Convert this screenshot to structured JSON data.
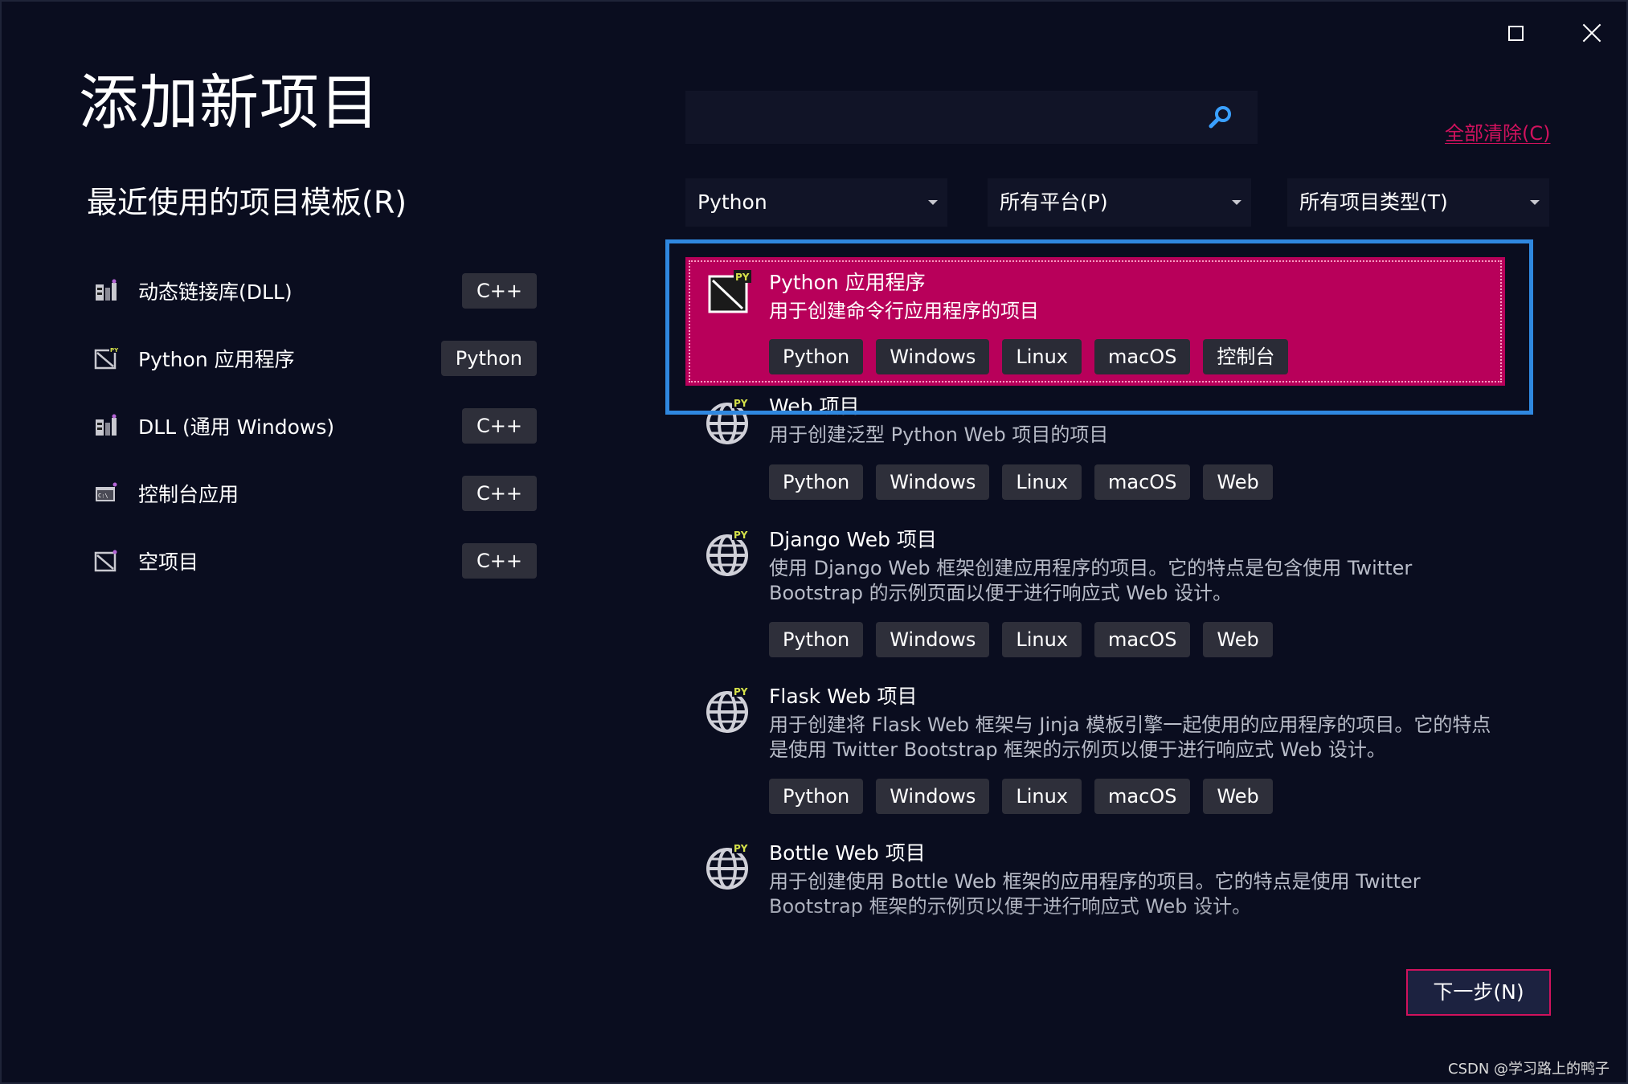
{
  "page_title": "添加新项目",
  "recent": {
    "title": "最近使用的项目模板(R)",
    "items": [
      {
        "label": "动态链接库(DLL)",
        "tag": "C++",
        "icon": "dll-icon"
      },
      {
        "label": "Python 应用程序",
        "tag": "Python",
        "icon": "python-app-icon"
      },
      {
        "label": "DLL (通用 Windows)",
        "tag": "C++",
        "icon": "dll-icon"
      },
      {
        "label": "控制台应用",
        "tag": "C++",
        "icon": "console-icon"
      },
      {
        "label": "空项目",
        "tag": "C++",
        "icon": "empty-project-icon"
      }
    ]
  },
  "search": {
    "value": "",
    "placeholder": ""
  },
  "clear_all_label": "全部清除(C)",
  "filters": {
    "language": "Python",
    "platform": "所有平台(P)",
    "project_type": "所有项目类型(T)"
  },
  "results": [
    {
      "title": "Python 应用程序",
      "desc": "用于创建命令行应用程序的项目",
      "tags": [
        "Python",
        "Windows",
        "Linux",
        "macOS",
        "控制台"
      ],
      "selected": true
    },
    {
      "title": "Web 项目",
      "desc": "用于创建泛型 Python Web 项目的项目",
      "tags": [
        "Python",
        "Windows",
        "Linux",
        "macOS",
        "Web"
      ]
    },
    {
      "title": "Django Web 项目",
      "desc": "使用 Django Web 框架创建应用程序的项目。它的特点是包含使用 Twitter Bootstrap 的示例页面以便于进行响应式 Web 设计。",
      "tags": [
        "Python",
        "Windows",
        "Linux",
        "macOS",
        "Web"
      ]
    },
    {
      "title": "Flask Web 项目",
      "desc": "用于创建将 Flask Web 框架与 Jinja 模板引擎一起使用的应用程序的项目。它的特点是使用 Twitter Bootstrap 框架的示例页以便于进行响应式 Web 设计。",
      "tags": [
        "Python",
        "Windows",
        "Linux",
        "macOS",
        "Web"
      ]
    },
    {
      "title": "Bottle Web 项目",
      "desc": "用于创建使用 Bottle Web 框架的应用程序的项目。它的特点是使用 Twitter Bootstrap 框架的示例页以便于进行响应式 Web 设计。",
      "tags": []
    }
  ],
  "next_button": "下一步(N)",
  "watermark": "CSDN @学习路上的鸭子",
  "colors": {
    "background": "#0a0d1f",
    "accent": "#d0125d",
    "selected": "#b8005a",
    "focus": "#2f88e0"
  }
}
